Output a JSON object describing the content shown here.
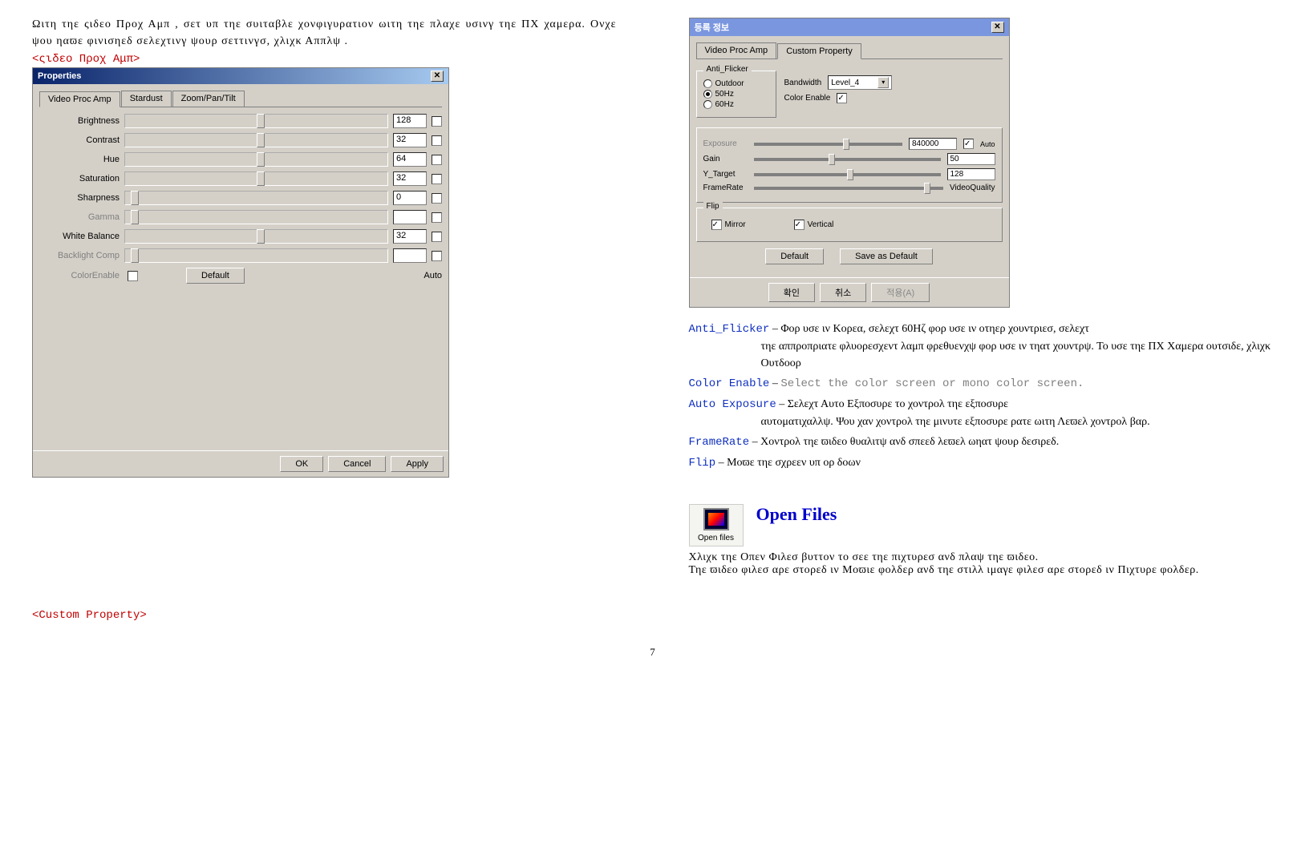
{
  "left": {
    "intro": "Ωιτη τηε  ςιδεο Προχ Αμπ , σετ υπ τηε συιταβλε χονφιγυρατιον ωιτη τηε πλαχε υσινγ τηε ΠΧ χαμερα. Ονχε ψου ηαϖε φινισηεδ σελεχτινγ ψουρ σεττινγσ, χλιχκ  Αππλψ  .",
    "red_label": "<ςιδεο Προχ Αμπ>",
    "dialog": {
      "title": "Properties",
      "tabs": [
        "Video Proc Amp",
        "Stardust",
        "Zoom/Pan/Tilt"
      ],
      "rows": [
        {
          "label": "Brightness",
          "val": "128",
          "pos": 50,
          "disabled": false
        },
        {
          "label": "Contrast",
          "val": "32",
          "pos": 50,
          "disabled": false
        },
        {
          "label": "Hue",
          "val": "64",
          "pos": 50,
          "disabled": false
        },
        {
          "label": "Saturation",
          "val": "32",
          "pos": 50,
          "disabled": false
        },
        {
          "label": "Sharpness",
          "val": "0",
          "pos": 2,
          "disabled": false
        },
        {
          "label": "Gamma",
          "val": "",
          "pos": 2,
          "disabled": true
        },
        {
          "label": "White Balance",
          "val": "32",
          "pos": 50,
          "disabled": false
        },
        {
          "label": "Backlight Comp",
          "val": "",
          "pos": 2,
          "disabled": true
        }
      ],
      "color_enable": "ColorEnable",
      "default_btn": "Default",
      "auto": "Auto",
      "ok": "OK",
      "cancel": "Cancel",
      "apply": "Apply"
    },
    "custom_label": "<Custom Property>"
  },
  "right": {
    "dialog": {
      "title": "등록 정보",
      "tabs": [
        "Video Proc Amp",
        "Custom Property"
      ],
      "anti_flicker": {
        "title": "Anti_Flicker",
        "opts": [
          "Outdoor",
          "50Hz",
          "60Hz"
        ],
        "selected": 1
      },
      "bandwidth_lbl": "Bandwidth",
      "bandwidth_val": "Level_4",
      "colorenable_lbl": "Color Enable",
      "rows": [
        {
          "lbl": "Exposure",
          "val": "840000",
          "auto": true,
          "disabled": true,
          "pos": 60
        },
        {
          "lbl": "Gain",
          "val": "50",
          "disabled": false,
          "pos": 40
        },
        {
          "lbl": "Y_Target",
          "val": "128",
          "disabled": false,
          "pos": 50
        }
      ],
      "framerate_lbl": "FrameRate",
      "framerate_end": "VideoQuality",
      "flip": {
        "title": "Flip",
        "mirror": "Mirror",
        "vertical": "Vertical"
      },
      "default": "Default",
      "save": "Save as Default",
      "ok": "확인",
      "cancel": "취소",
      "apply": "적용(A)"
    },
    "defs": [
      {
        "key": "Anti_Flicker",
        "dash": " – ",
        "body": "Φορ υσε ιν Κορεα, σελεχτ 60Ηζ φορ υσε ιν οτηερ χουντριεσ, σελεχτ",
        "cont": "τηε αππροπριατε φλυορεσχεντ λαμπ φρεθυενχψ φορ υσε ιν τηατ χουντρψ.  Το υσε τηε ΠΧ Χαμερα ουτσιδε, χλιχκ Ουτδοορ"
      },
      {
        "key": "Color Enable",
        "dash": " – ",
        "body_gray": "Select the color screen or mono color screen."
      },
      {
        "key": "Auto  Exposure",
        "dash": "  –  ",
        "body": "Σελεχτ   Αυτο  Εξποσυρε   το  χοντρολ  τηε  εξποσυρε",
        "cont": "αυτοματιχαλλψ. Ψου χαν χοντρολ τηε μινυτε εξποσυρε ρατε ωιτη Λεϖελ χοντρολ βαρ."
      },
      {
        "key": "FrameRate",
        "dash": " – ",
        "body": "Χοντρολ τηε ϖιδεο θυαλιτψ ανδ σπεεδ λεϖελ ωηατ ψουρ δεσιρεδ."
      },
      {
        "key": "Flip",
        "dash": " – ",
        "body": "Μοϖε τηε σχρεεν υπ ορ δοων"
      }
    ],
    "openfiles": {
      "icon_caption": "Open files",
      "title": "Open Files",
      "line1": "Χλιχκ τηε   Οπεν Φιλεσ   βυττον το σεε τηε πιχτυρεσ ανδ πλαψ τηε ϖιδεο.",
      "line2": "Τηε ϖιδεο φιλεσ αρε στορεδ ιν   Μοϖιε   φολδερ ανδ τηε στιλλ ιμαγε φιλεσ αρε στορεδ ιν   Πιχτυρε   φολδερ."
    }
  },
  "page": "7"
}
